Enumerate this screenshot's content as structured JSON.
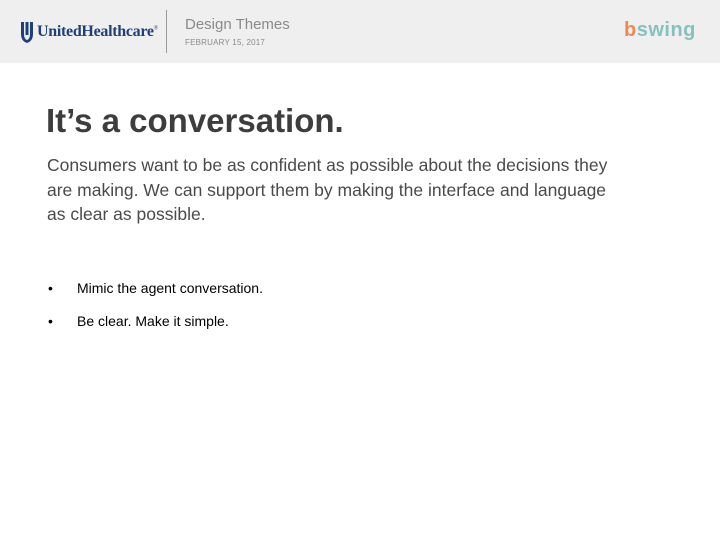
{
  "header": {
    "logo_text": "UnitedHealthcare",
    "logo_reg": "®",
    "deck_title": "Design Themes",
    "deck_date": "FEBRUARY 15, 2017",
    "partner_logo_b": "b",
    "partner_logo_rest": "swing",
    "colors": {
      "background": "#efefef",
      "uhc_blue": "#1f3f78",
      "bswing_orange": "#ed8a52",
      "bswing_teal": "#86c2bc"
    }
  },
  "slide": {
    "title": "It’s a conversation.",
    "lead": "Consumers want to be as confident as possible about the decisions they are making.  We can support them by making the interface and language as clear as possible.",
    "bullet_marker": "•",
    "bullets": [
      "Mimic the agent conversation.",
      "Be clear. Make it simple."
    ]
  }
}
